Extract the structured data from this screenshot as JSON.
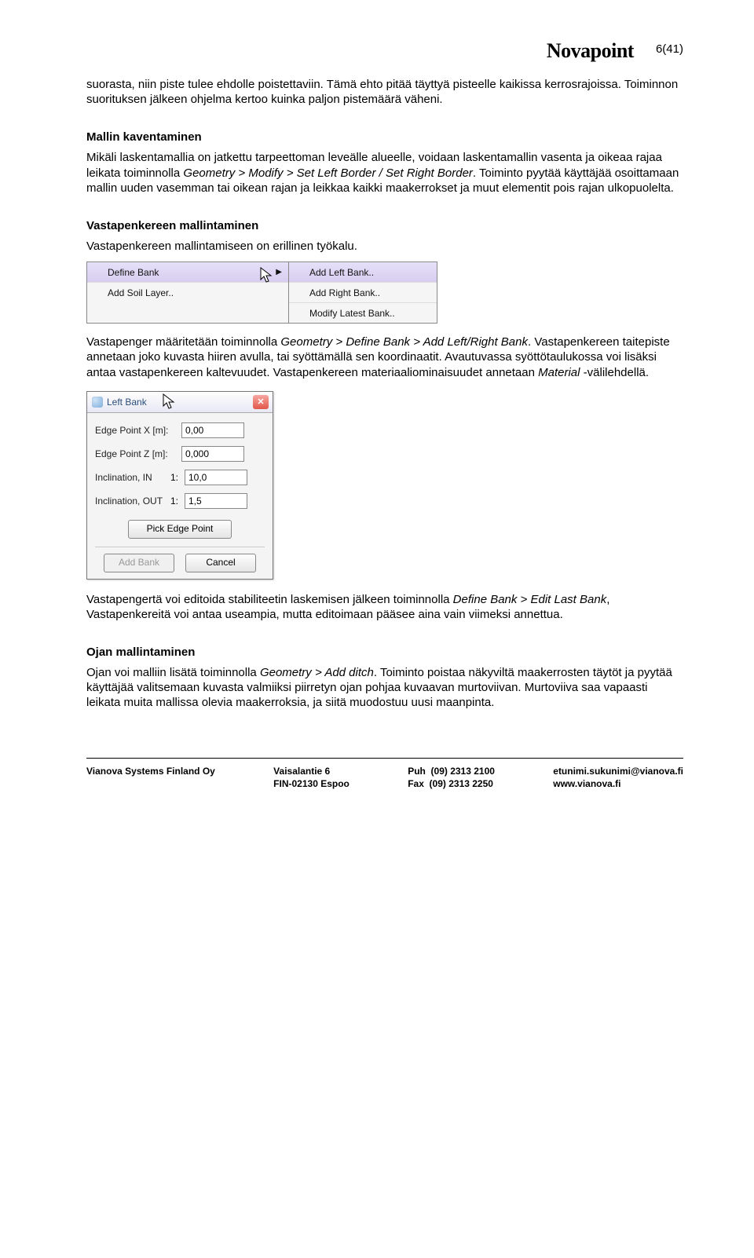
{
  "header": {
    "logo": "Novapoint",
    "pagenum": "6(41)"
  },
  "para_intro": "suorasta, niin piste tulee ehdolle poistettaviin. Tämä ehto pitää täyttyä pisteelle kaikissa kerrosrajoissa. Toiminnon suorituksen jälkeen ohjelma kertoo kuinka paljon pistemäärä väheni.",
  "sec1": {
    "title": "Mallin kaventaminen",
    "p1a": "Mikäli laskentamallia on jatkettu tarpeettoman leveälle alueelle, voidaan laskentamallin vasenta ja oikeaa rajaa leikata toiminnolla ",
    "p1i": "Geometry > Modify > Set Left Border / Set Right Border",
    "p1b": ". Toiminto pyytää käyttäjää osoittamaan mallin uuden vasemman tai oikean rajan ja leikkaa kaikki maakerrokset ja muut elementit pois rajan ulkopuolelta."
  },
  "sec2": {
    "title": "Vastapenkereen mallintaminen",
    "p1": "Vastapenkereen mallintamiseen on erillinen työkalu.",
    "menu": {
      "left": [
        {
          "label": "Define Bank",
          "arrow": true,
          "hl": true
        },
        {
          "label": "Add Soil Layer.."
        }
      ],
      "right": [
        {
          "label": "Add Left Bank..",
          "hl": true
        },
        {
          "label": "Add Right Bank.."
        },
        {
          "label": "Modify Latest Bank.."
        }
      ]
    },
    "p2a": "Vastapenger määritetään toiminnolla ",
    "p2i": "Geometry > Define Bank > Add Left/Right Bank",
    "p2b": ". Vastapenkereen taitepiste annetaan joko kuvasta hiiren avulla, tai syöttämällä sen koordinaatit. Avautuvassa syöttötaulukossa voi lisäksi antaa vastapenkereen kaltevuudet. Vastapenkereen materiaaliominaisuudet annetaan ",
    "p2i2": "Material",
    "p2c": " -välilehdellä.",
    "dialog": {
      "title": "Left Bank",
      "fields": [
        {
          "label": "Edge Point  X [m]:",
          "value": "0,00"
        },
        {
          "label": "Edge Point  Z [m]:",
          "value": "0,000"
        },
        {
          "label": "Inclination, IN",
          "ratio": "1:",
          "value": "10,0"
        },
        {
          "label": "Inclination, OUT",
          "ratio": "1:",
          "value": "1,5"
        }
      ],
      "btn_pick": "Pick Edge Point",
      "btn_add": "Add Bank",
      "btn_cancel": "Cancel"
    },
    "p3a": "Vastapengertä voi editoida stabiliteetin laskemisen jälkeen toiminnolla ",
    "p3i": "Define Bank > Edit Last Bank",
    "p3b": ", Vastapenkereitä voi antaa useampia, mutta editoimaan pääsee aina vain viimeksi annettua."
  },
  "sec3": {
    "title": "Ojan mallintaminen",
    "p1a": "Ojan voi malliin lisätä toiminnolla ",
    "p1i": "Geometry > Add ditch",
    "p1b": ". Toiminto poistaa näkyviltä maakerrosten täytöt ja pyytää käyttäjää valitsemaan kuvasta valmiiksi piirretyn ojan pohjaa kuvaavan murtoviivan. Murtoviiva saa vapaasti leikata muita mallissa olevia maakerroksia, ja siitä muodostuu uusi maanpinta."
  },
  "footer": {
    "company": "Vianova Systems Finland Oy",
    "addr1": "Vaisalantie 6",
    "addr2": "FIN-02130 Espoo",
    "phone": "Puh  (09) 2313 2100",
    "fax": "Fax  (09) 2313 2250",
    "email": "etunimi.sukunimi@vianova.fi",
    "web": "www.vianova.fi"
  }
}
